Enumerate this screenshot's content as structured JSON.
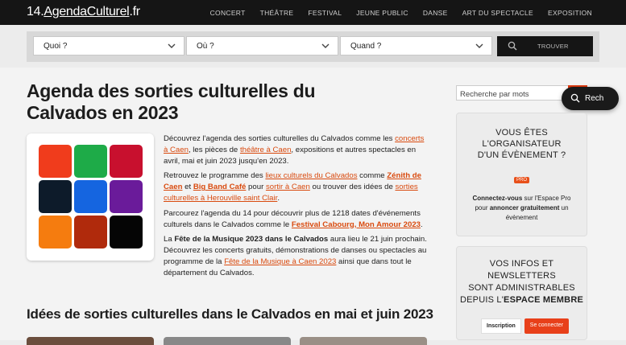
{
  "header": {
    "logo_main": "14.",
    "logo_brand": "AgendaCulturel",
    "logo_tld": ".fr",
    "nav": [
      "CONCERT",
      "THÉÂTRE",
      "FESTIVAL",
      "JEUNE PUBLIC",
      "DANSE",
      "ART DU SPECTACLE",
      "EXPOSITION"
    ]
  },
  "search": {
    "what": "Quoi ?",
    "where": "Où ?",
    "when": "Quand ?",
    "find_label": "TROUVER"
  },
  "main": {
    "title": "Agenda des sorties culturelles du Calvados en 2023",
    "p1_a": "Découvrez l'agenda des sorties culturelles du Calvados comme les ",
    "p1_l1": "concerts à Caen",
    "p1_b": ", les pièces de ",
    "p1_l2": "théâtre à Caen",
    "p1_c": ", expositions et autres spectacles en avril, mai et juin 2023 jusqu'en 2023.",
    "p2_a": "Retrouvez le programme des ",
    "p2_l1": "lieux culturels du Calvados",
    "p2_b": " comme ",
    "p2_l2": "Zénith de Caen",
    "p2_c": " et ",
    "p2_l3": "Big Band Café",
    "p2_d": " pour ",
    "p2_l4": "sortir à Caen",
    "p2_e": " ou trouver des idées de ",
    "p2_l5": "sorties culturelles à Herouville saint Clair",
    "p2_f": ".",
    "p3_a": "Parcourez l'agenda du 14 pour découvrir plus de 1218 dates d'événements culturels dans le Calvados comme le ",
    "p3_l1": "Festival Cabourg, Mon Amour 2023",
    "p3_b": ".",
    "p4_a": "La ",
    "p4_b1": "Fête de la Musique 2023 dans le Calvados",
    "p4_b": " aura lieu le 21 juin prochain. Découvrez les concerts gratuits, démonstrations de danses ou spectacles au programme de la ",
    "p4_l1": "Fête de la Musique à Caen 2023",
    "p4_c": " ainsi que dans tout le département du Calvados.",
    "subtitle": "Idées de sorties culturelles dans le Calvados en mai et juin 2023"
  },
  "tiles": [
    "#f03c1c",
    "#1eab48",
    "#c8102e",
    "#0d1b2a",
    "#1565e0",
    "#6a1b9a",
    "#f57c0f",
    "#b02a0c",
    "#050505"
  ],
  "sidebar": {
    "search_placeholder": "Recherche par mots",
    "float_label": "Rech",
    "box1_title_l1": "VOUS ÊTES",
    "box1_title_l2": "L'ORGANISATEUR",
    "box1_title_l3": "D'UN ÉVÈNEMENT ?",
    "pro_badge": "PRO",
    "box1_t_b1": "Connectez-vous",
    "box1_t_a": " sur l'Espace Pro pour ",
    "box1_t_b2": "annoncer gratuitement",
    "box1_t_c": " un évènement",
    "box2_l1": "VOS INFOS ET",
    "box2_l2": "NEWSLETTERS",
    "box2_l3": "SONT ADMINISTRABLES",
    "box2_l4a": "DEPUIS L'",
    "box2_l4b": "ESPACE MEMBRE",
    "signup": "Inscription",
    "login": "Se connecter"
  },
  "colors": {
    "accent": "#e8401a",
    "dark": "#151515",
    "link": "#d94a0e"
  }
}
